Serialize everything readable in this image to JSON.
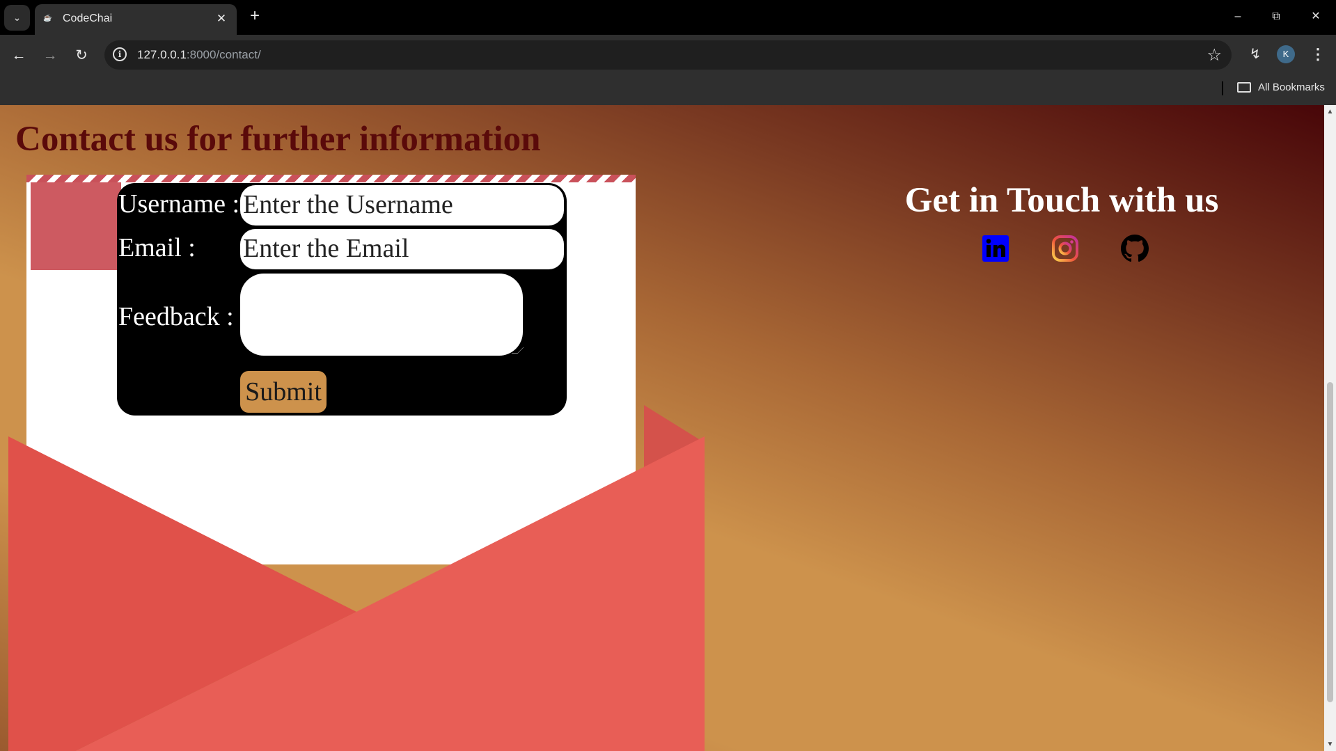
{
  "browser": {
    "tab_title": "CodeChai",
    "url_host": "127.0.0.1",
    "url_rest": ":8000/contact/",
    "profile_initial": "K",
    "bookmarks_label": "All Bookmarks"
  },
  "page": {
    "heading": "Contact us for further information",
    "form": {
      "username_label": "Username :",
      "username_placeholder": "Enter the Username",
      "email_label": "Email :",
      "email_placeholder": "Enter the Email",
      "feedback_label": "Feedback :",
      "feedback_value": "",
      "submit_label": "Submit"
    },
    "touch_heading": "Get in Touch with us",
    "social": [
      "linkedin-icon",
      "instagram-icon",
      "github-icon"
    ]
  },
  "colors": {
    "heading": "#5a0a0a",
    "envelope": "#e85b53",
    "button": "#cd924c",
    "linkedin": "#0000ff"
  }
}
